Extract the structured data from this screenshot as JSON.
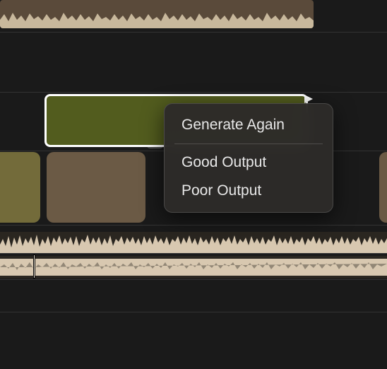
{
  "contextMenu": {
    "items": [
      {
        "label": "Generate Again",
        "name": "menu-generate-again"
      },
      {
        "label": "Good Output",
        "name": "menu-good-output"
      },
      {
        "label": "Poor Output",
        "name": "menu-poor-output"
      }
    ]
  },
  "colors": {
    "selectedClip": "#525c1e",
    "oliveClip": "#736b3a",
    "tanClip": "#6b5a45",
    "waveformFill": "#d8c8b0",
    "waveformDark": "#5a4a3a",
    "background": "#1a1a1a",
    "menuBg": "rgba(45,43,41,0.96)",
    "menuText": "#e8e8e8"
  }
}
